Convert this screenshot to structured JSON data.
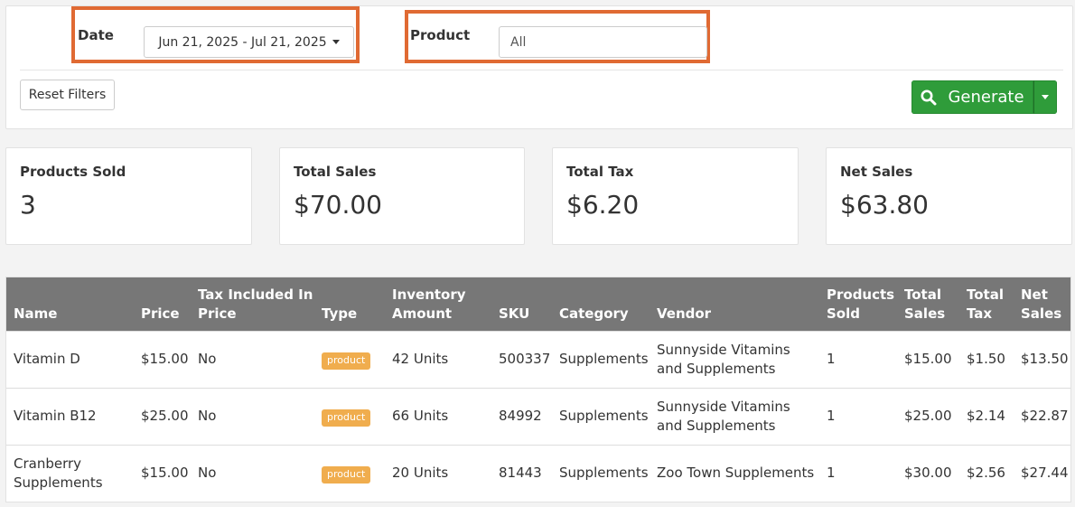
{
  "filters": {
    "date_label": "Date",
    "date_range": "Jun 21, 2025 - Jul 21, 2025",
    "product_label": "Product",
    "product_value": "All",
    "reset_label": "Reset Filters",
    "generate_label": "Generate",
    "highlight_color": "#e06a33",
    "generate_color": "#2f9c3a"
  },
  "summary": [
    {
      "title": "Products Sold",
      "value": "3"
    },
    {
      "title": "Total Sales",
      "value": "$70.00"
    },
    {
      "title": "Total Tax",
      "value": "$6.20"
    },
    {
      "title": "Net Sales",
      "value": "$63.80"
    }
  ],
  "table": {
    "headers": [
      "Name",
      "Price",
      "Tax Included In Price",
      "Type",
      "Inventory Amount",
      "SKU",
      "Category",
      "Vendor",
      "Products Sold",
      "Total Sales",
      "Total Tax",
      "Net Sales"
    ],
    "rows": [
      [
        "Vitamin D",
        "$15.00",
        "No",
        "product",
        "42 Units",
        "500337",
        "Supplements",
        "Sunnyside Vitamins and Supplements",
        "1",
        "$15.00",
        "$1.50",
        "$13.50"
      ],
      [
        "Vitamin B12",
        "$25.00",
        "No",
        "product",
        "66 Units",
        "84992",
        "Supplements",
        "Sunnyside Vitamins and Supplements",
        "1",
        "$25.00",
        "$2.14",
        "$22.87"
      ],
      [
        "Cranberry Supplements",
        "$15.00",
        "No",
        "product",
        "20 Units",
        "81443",
        "Supplements",
        "Zoo Town Supplements",
        "1",
        "$30.00",
        "$2.56",
        "$27.44"
      ]
    ],
    "badge_color": "#f0ad4e",
    "header_color": "#777777"
  }
}
